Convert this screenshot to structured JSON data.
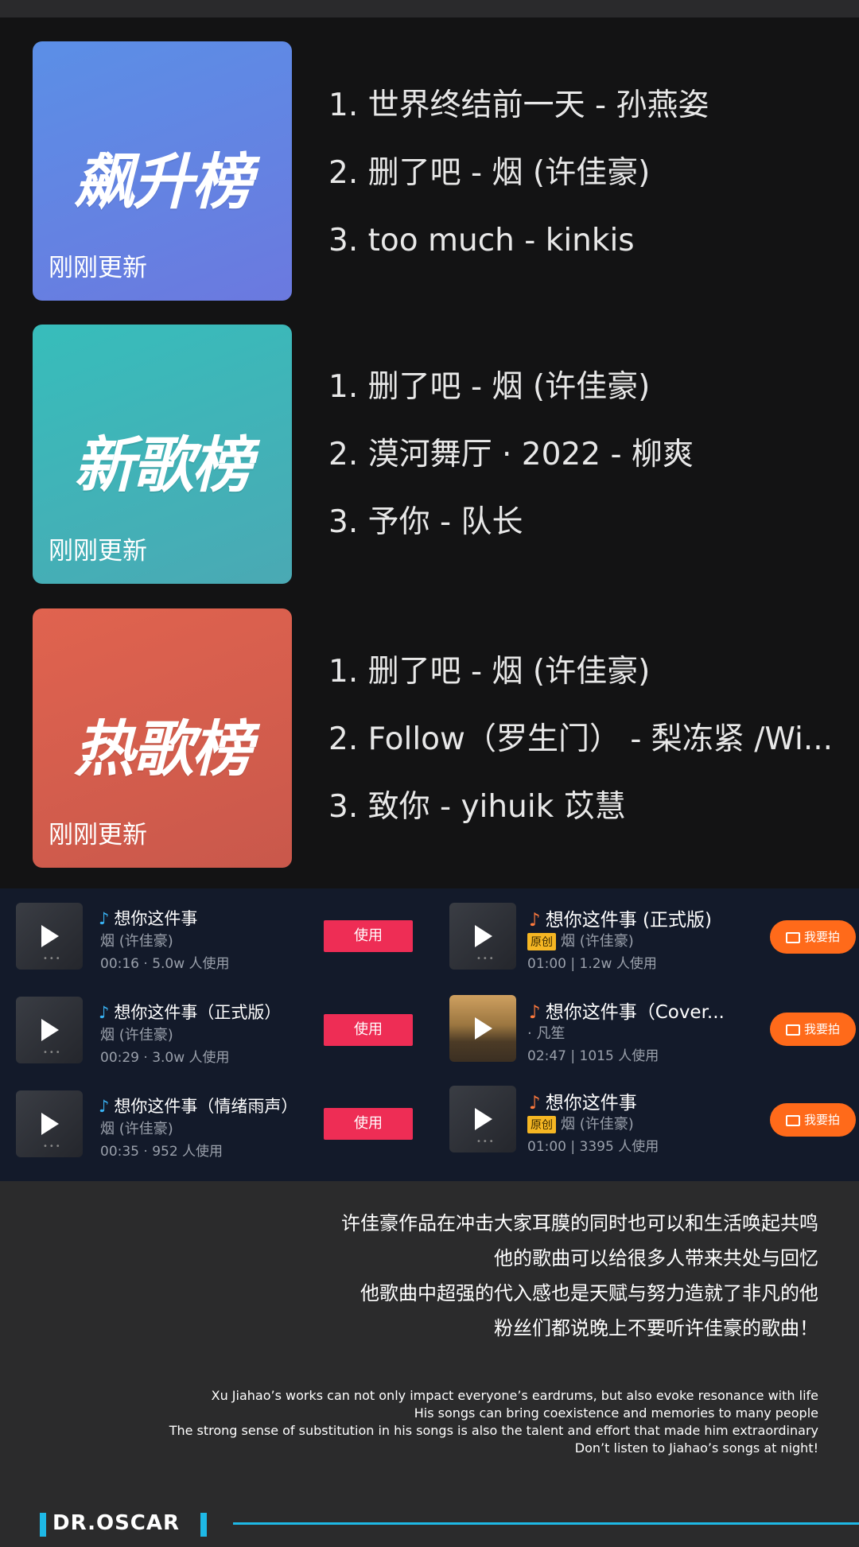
{
  "charts": [
    {
      "title": "飙升榜",
      "subtitle": "刚刚更新",
      "color_top": "#5b8fe6",
      "color_bottom": "#6b79df",
      "items": [
        "1. 世界终结前一天 - 孙燕姿",
        "2. 删了吧 - 烟 (许佳豪)",
        "3. too much - kinkis"
      ]
    },
    {
      "title": "新歌榜",
      "subtitle": "刚刚更新",
      "color_top": "#37bdbb",
      "color_bottom": "#4aa9b4",
      "items": [
        "1. 删了吧 - 烟 (许佳豪)",
        "2. 漠河舞厅 · 2022 - 柳爽",
        "3. 予你 - 队长"
      ]
    },
    {
      "title": "热歌榜",
      "subtitle": "刚刚更新",
      "color_top": "#e0634f",
      "color_bottom": "#c9584b",
      "items": [
        "1. 删了吧 - 烟 (许佳豪)",
        "2. Follow（罗生门） - 梨冻紧 /Wi...",
        "3. 致你 - yihuik 苡慧"
      ]
    }
  ],
  "songs_left": [
    {
      "title": "想你这件事",
      "artist": "烟 (许佳豪)",
      "meta": "00:16 · 5.0w 人使用",
      "button": "使用"
    },
    {
      "title": "想你这件事（正式版）",
      "artist": "烟 (许佳豪)",
      "meta": "00:29 · 3.0w 人使用",
      "button": "使用"
    },
    {
      "title": "想你这件事（情绪雨声）",
      "artist": "烟 (许佳豪)",
      "meta": "00:35 · 952 人使用",
      "button": "使用"
    }
  ],
  "songs_right": [
    {
      "title": "想你这件事 (正式版)",
      "badge": "原创",
      "artist": "烟 (许佳豪)",
      "meta": "01:00 | 1.2w 人使用",
      "button": "我要拍"
    },
    {
      "title": "想你这件事（Cover...",
      "badge": "",
      "artist": "· 凡笙",
      "meta": "02:47 | 1015 人使用",
      "button": "我要拍"
    },
    {
      "title": "想你这件事",
      "badge": "原创",
      "artist": "烟 (许佳豪)",
      "meta": "01:00 | 3395 人使用",
      "button": "我要拍"
    }
  ],
  "caption": {
    "zh": [
      "许佳豪作品在冲击大家耳膜的同时也可以和生活唤起共鸣",
      "他的歌曲可以给很多人带来共处与回忆",
      "他歌曲中超强的代入感也是天赋与努力造就了非凡的他",
      "粉丝们都说晚上不要听许佳豪的歌曲！"
    ],
    "en": [
      "Xu Jiahao’s works can not only impact everyone’s eardrums, but also evoke resonance with life",
      "His songs can bring coexistence and memories to many people",
      "The strong sense of substitution in his songs is also the talent and effort that made him extraordinary",
      "Don’t listen to Jiahao’s songs at night!"
    ]
  },
  "brand": "DR.OSCAR",
  "accent": "#1eb8e6"
}
